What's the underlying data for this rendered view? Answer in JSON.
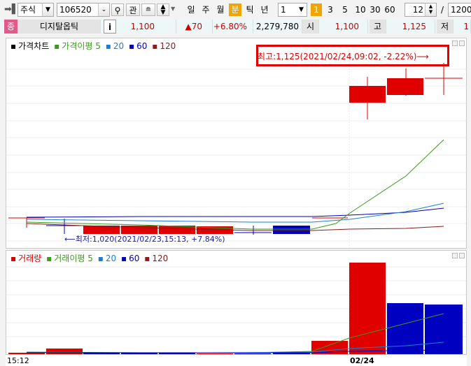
{
  "toolbar": {
    "market_label": "주식",
    "code_value": "106520",
    "search_icon": "search-icon",
    "kwan_label": "관",
    "period_buttons": [
      "일",
      "주",
      "월",
      "분",
      "틱",
      "년"
    ],
    "active_period": "분",
    "interval_value": "1",
    "quick_intervals": [
      "1",
      "3",
      "5",
      "10",
      "30",
      "60"
    ],
    "active_quick": "1",
    "count_value": "12",
    "slash": "/",
    "total_value": "1200"
  },
  "quote": {
    "badge": "종",
    "name": "디지탈옵틱",
    "info_button": "i",
    "price": "1,100",
    "change": "▲70",
    "change_pct": "+6.80%",
    "volume": "2,279,780",
    "open_label": "시",
    "open_value": "1,100",
    "high_label": "고",
    "high_value": "1,125",
    "low_label": "저",
    "low_value": "1"
  },
  "price_chart": {
    "legend": [
      {
        "text": "가격차트",
        "color": "#000000"
      },
      {
        "text": "가격이평 5",
        "color": "#3a9a1a"
      },
      {
        "text": "20",
        "color": "#1e7fd0"
      },
      {
        "text": "60",
        "color": "#0000c0"
      },
      {
        "text": "120",
        "color": "#8b1a1a"
      }
    ],
    "high_annotation": "최고:1,125(2021/02/24,09:02, -2.22%)⟶",
    "low_annotation": "⟵최저:1,020(2021/02/23,15:13, +7.84%)"
  },
  "volume_chart": {
    "legend": [
      {
        "text": "거래량",
        "color": "#d00000"
      },
      {
        "text": "거래이평 5",
        "color": "#3a9a1a"
      },
      {
        "text": "20",
        "color": "#1e7fd0"
      },
      {
        "text": "60",
        "color": "#0000c0"
      },
      {
        "text": "120",
        "color": "#8b1a1a"
      }
    ]
  },
  "x_axis": {
    "left_label": "15:12",
    "date_label": "02/24"
  },
  "colors": {
    "up": "#e00000",
    "down": "#0000c0",
    "ma5": "#3a9a1a",
    "ma20": "#1e7fd0",
    "ma60": "#0000c0",
    "ma120": "#8b1a1a"
  }
}
